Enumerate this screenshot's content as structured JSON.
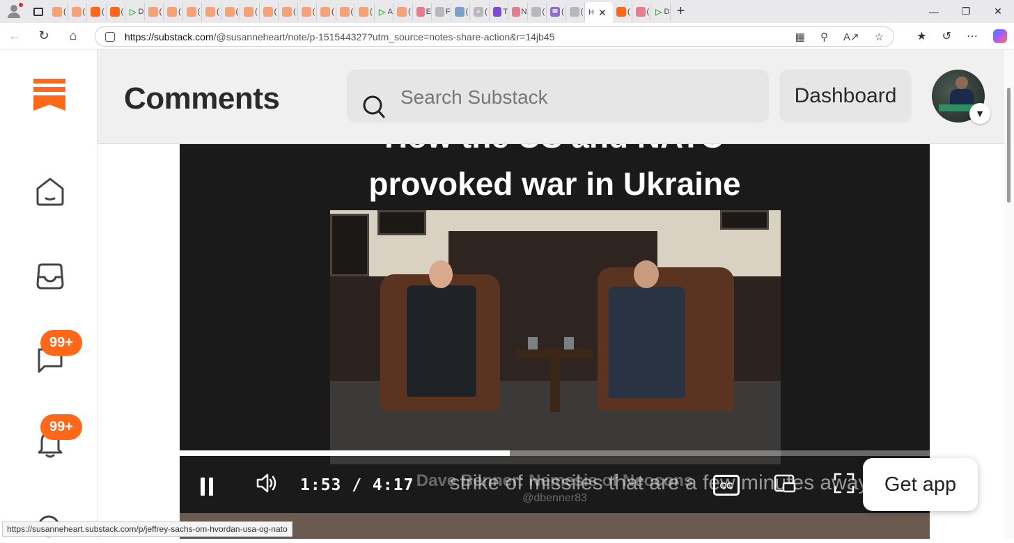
{
  "browser": {
    "tabs": [
      {
        "icon": "substack-icon",
        "label": "("
      },
      {
        "icon": "substack-icon",
        "label": "("
      },
      {
        "icon": "substack-icon",
        "label": "("
      },
      {
        "icon": "substack-icon",
        "label": "("
      },
      {
        "icon": "play-icon",
        "label": "D"
      },
      {
        "icon": "substack-icon",
        "label": "("
      },
      {
        "icon": "substack-icon",
        "label": "("
      },
      {
        "icon": "substack-icon",
        "label": "("
      },
      {
        "icon": "substack-icon",
        "label": "("
      },
      {
        "icon": "substack-icon",
        "label": "("
      },
      {
        "icon": "substack-icon",
        "label": "("
      },
      {
        "icon": "substack-icon",
        "label": "("
      },
      {
        "icon": "substack-icon",
        "label": "("
      },
      {
        "icon": "substack-icon",
        "label": "("
      },
      {
        "icon": "substack-icon",
        "label": "("
      },
      {
        "icon": "substack-icon",
        "label": "("
      },
      {
        "icon": "substack-icon",
        "label": "("
      },
      {
        "icon": "play-icon",
        "label": "A"
      },
      {
        "icon": "substack-icon",
        "label": "("
      },
      {
        "icon": "youtube-icon",
        "label": "E"
      },
      {
        "icon": "news-icon",
        "label": "F"
      },
      {
        "icon": "translate-icon",
        "label": "("
      },
      {
        "icon": "search-icon",
        "label": "("
      },
      {
        "icon": "yahoo-icon",
        "label": "T"
      },
      {
        "icon": "youtube-icon",
        "label": "N"
      },
      {
        "icon": "robot-icon",
        "label": "("
      },
      {
        "icon": "mail-icon",
        "label": "("
      },
      {
        "icon": "news-icon",
        "label": "("
      }
    ],
    "active_tab_label": "H",
    "after_tabs": [
      {
        "icon": "substack-icon",
        "label": "("
      },
      {
        "icon": "youtube-icon",
        "label": "("
      },
      {
        "icon": "play-icon",
        "label": "D"
      }
    ],
    "url_host": "https://substack.com",
    "url_path": "/@susanneheart/note/p-151544327?utm_source=notes-share-action&r=14jb45"
  },
  "header": {
    "title": "Comments",
    "search_placeholder": "Search Substack",
    "dashboard_label": "Dashboard"
  },
  "sidebar": {
    "chat_badge": "99+",
    "notifications_badge": "99+"
  },
  "video": {
    "title_cut": "How the US and NATO",
    "title": "provoked war in Ukraine",
    "credit": "Dave Benner: Nemesis of Neocons",
    "handle": "@dbenner83",
    "caption": "strike of missiles that are a few minutes away",
    "timecode": "1:53 / 4:17",
    "progress": 0.44,
    "cc_label": "CC"
  },
  "get_app_label": "Get app",
  "status_url": "https://susanneheart.substack.com/p/jeffrey-sachs-om-hvordan-usa-og-nato",
  "colors": {
    "brand": "#ff6719",
    "header_bg": "#f0f0f0",
    "video_bg": "#1a1a1a"
  }
}
